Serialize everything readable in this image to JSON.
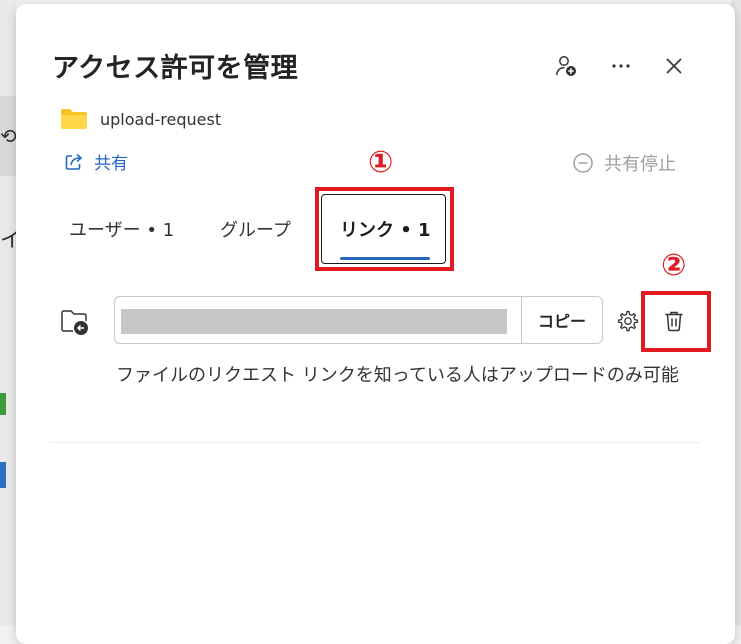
{
  "dialog": {
    "title": "アクセス許可を管理",
    "folder_name": "upload-request",
    "share_label": "共有",
    "stop_share_label": "共有停止"
  },
  "tabs": [
    {
      "label": "ユーザー • 1"
    },
    {
      "label": "グループ"
    },
    {
      "label": "リンク • 1",
      "active": true
    }
  ],
  "link": {
    "copy_label": "コピー",
    "description": "ファイルのリクエスト リンクを知っている人はアップロードのみ可能"
  },
  "annotations": {
    "first": "①",
    "second": "②",
    "color": "#e01b24"
  },
  "colors": {
    "accent": "#2666c4",
    "disabled": "#a0a0a0",
    "folder": "#f7c325"
  },
  "icons": [
    "add-person-icon",
    "more-icon",
    "close-icon",
    "folder-icon",
    "share-icon",
    "stop-share-icon",
    "folder-link-icon",
    "gear-icon",
    "trash-icon"
  ]
}
